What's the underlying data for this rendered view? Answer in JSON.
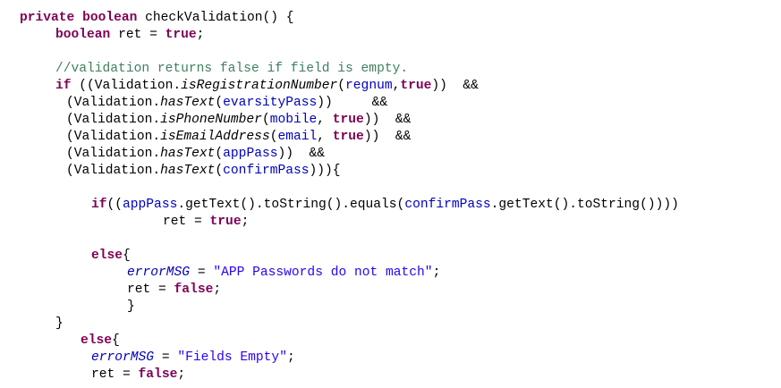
{
  "code": {
    "lines": [
      [
        {
          "t": "private",
          "c": "kw"
        },
        {
          "t": " ",
          "c": "plain"
        },
        {
          "t": "boolean",
          "c": "kw"
        },
        {
          "t": " checkValidation() {",
          "c": "plain"
        }
      ],
      [
        {
          "t": "boolean",
          "c": "kw"
        },
        {
          "t": " ret = ",
          "c": "plain"
        },
        {
          "t": "true",
          "c": "kw"
        },
        {
          "t": ";",
          "c": "plain"
        }
      ],
      [],
      [
        {
          "t": "//validation returns false if field is empty.",
          "c": "cm"
        }
      ],
      [
        {
          "t": "if",
          "c": "kw"
        },
        {
          "t": " ((Validation.",
          "c": "plain"
        },
        {
          "t": "isRegistrationNumber",
          "c": "smeth"
        },
        {
          "t": "(",
          "c": "plain"
        },
        {
          "t": "regnum",
          "c": "fld"
        },
        {
          "t": ",",
          "c": "plain"
        },
        {
          "t": "true",
          "c": "kw"
        },
        {
          "t": "))  &&",
          "c": "plain"
        }
      ],
      [
        {
          "t": "(Validation.",
          "c": "plain"
        },
        {
          "t": "hasText",
          "c": "smeth"
        },
        {
          "t": "(",
          "c": "plain"
        },
        {
          "t": "evarsityPass",
          "c": "fld"
        },
        {
          "t": "))     &&",
          "c": "plain"
        }
      ],
      [
        {
          "t": "(Validation.",
          "c": "plain"
        },
        {
          "t": "isPhoneNumber",
          "c": "smeth"
        },
        {
          "t": "(",
          "c": "plain"
        },
        {
          "t": "mobile",
          "c": "fld"
        },
        {
          "t": ", ",
          "c": "plain"
        },
        {
          "t": "true",
          "c": "kw"
        },
        {
          "t": "))  &&",
          "c": "plain"
        }
      ],
      [
        {
          "t": "(Validation.",
          "c": "plain"
        },
        {
          "t": "isEmailAddress",
          "c": "smeth"
        },
        {
          "t": "(",
          "c": "plain"
        },
        {
          "t": "email",
          "c": "fld"
        },
        {
          "t": ", ",
          "c": "plain"
        },
        {
          "t": "true",
          "c": "kw"
        },
        {
          "t": "))  &&",
          "c": "plain"
        }
      ],
      [
        {
          "t": "(Validation.",
          "c": "plain"
        },
        {
          "t": "hasText",
          "c": "smeth"
        },
        {
          "t": "(",
          "c": "plain"
        },
        {
          "t": "appPass",
          "c": "fld"
        },
        {
          "t": "))  &&",
          "c": "plain"
        }
      ],
      [
        {
          "t": "(Validation.",
          "c": "plain"
        },
        {
          "t": "hasText",
          "c": "smeth"
        },
        {
          "t": "(",
          "c": "plain"
        },
        {
          "t": "confirmPass",
          "c": "fld"
        },
        {
          "t": "))){",
          "c": "plain"
        }
      ],
      [],
      [
        {
          "t": "if",
          "c": "kw"
        },
        {
          "t": "((",
          "c": "plain"
        },
        {
          "t": "appPass",
          "c": "fld"
        },
        {
          "t": ".getText().toString().equals(",
          "c": "plain"
        },
        {
          "t": "confirmPass",
          "c": "fld"
        },
        {
          "t": ".getText().toString())))",
          "c": "plain"
        }
      ],
      [
        {
          "t": "ret = ",
          "c": "plain"
        },
        {
          "t": "true",
          "c": "kw"
        },
        {
          "t": ";",
          "c": "plain"
        }
      ],
      [],
      [
        {
          "t": "else",
          "c": "kw"
        },
        {
          "t": "{",
          "c": "plain"
        }
      ],
      [
        {
          "t": "errorMSG",
          "c": "sfld"
        },
        {
          "t": " = ",
          "c": "plain"
        },
        {
          "t": "\"APP Passwords do not match\"",
          "c": "str"
        },
        {
          "t": ";",
          "c": "plain"
        }
      ],
      [
        {
          "t": "ret = ",
          "c": "plain"
        },
        {
          "t": "false",
          "c": "kw"
        },
        {
          "t": ";",
          "c": "plain"
        }
      ],
      [
        {
          "t": "}",
          "c": "plain"
        }
      ],
      [
        {
          "t": "}",
          "c": "plain"
        }
      ],
      [
        {
          "t": "else",
          "c": "kw"
        },
        {
          "t": "{",
          "c": "plain"
        }
      ],
      [
        {
          "t": "errorMSG",
          "c": "sfld"
        },
        {
          "t": " = ",
          "c": "plain"
        },
        {
          "t": "\"Fields Empty\"",
          "c": "str"
        },
        {
          "t": ";",
          "c": "plain"
        }
      ],
      [
        {
          "t": "ret = ",
          "c": "plain"
        },
        {
          "t": "false",
          "c": "kw"
        },
        {
          "t": ";",
          "c": "plain"
        }
      ]
    ]
  }
}
